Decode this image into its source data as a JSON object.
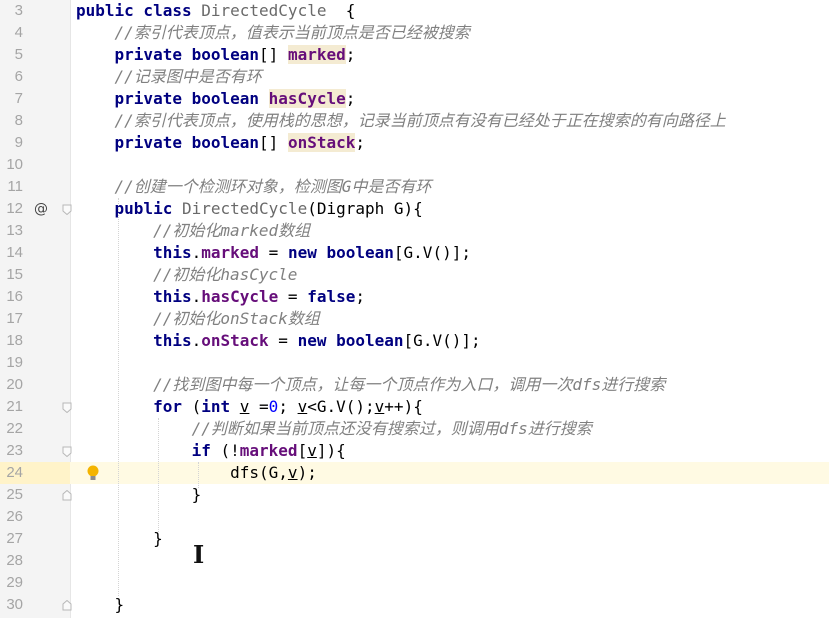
{
  "editor": {
    "lines": [
      {
        "n": "3",
        "tokens": [
          [
            "kw",
            "public class "
          ],
          [
            "cls",
            "DirectedCycle"
          ],
          [
            "",
            "  {"
          ]
        ]
      },
      {
        "n": "4",
        "tokens": [
          [
            "",
            "    "
          ],
          [
            "cm",
            "//索引代表顶点，值表示当前顶点是否已经被搜索"
          ]
        ]
      },
      {
        "n": "5",
        "tokens": [
          [
            "",
            "    "
          ],
          [
            "kw",
            "private boolean"
          ],
          [
            "",
            "[] "
          ],
          [
            "field hl",
            "marked"
          ],
          [
            "",
            ";"
          ]
        ]
      },
      {
        "n": "6",
        "tokens": [
          [
            "",
            "    "
          ],
          [
            "cm",
            "//记录图中是否有环"
          ]
        ]
      },
      {
        "n": "7",
        "tokens": [
          [
            "",
            "    "
          ],
          [
            "kw",
            "private boolean "
          ],
          [
            "field hl",
            "hasCycle"
          ],
          [
            "",
            ";"
          ]
        ]
      },
      {
        "n": "8",
        "tokens": [
          [
            "",
            "    "
          ],
          [
            "cm",
            "//索引代表顶点，使用栈的思想，记录当前顶点有没有已经处于正在搜索的有向路径上"
          ]
        ]
      },
      {
        "n": "9",
        "tokens": [
          [
            "",
            "    "
          ],
          [
            "kw",
            "private boolean"
          ],
          [
            "",
            "[] "
          ],
          [
            "field hl",
            "onStack"
          ],
          [
            "",
            ";"
          ]
        ]
      },
      {
        "n": "10",
        "tokens": []
      },
      {
        "n": "11",
        "tokens": [
          [
            "",
            "    "
          ],
          [
            "cm",
            "//创建一个检测环对象，检测图G中是否有环"
          ]
        ]
      },
      {
        "n": "12",
        "marker": "@",
        "tokens": [
          [
            "",
            "    "
          ],
          [
            "kw",
            "public "
          ],
          [
            "cls",
            "DirectedCycle"
          ],
          [
            "",
            "(Digraph G){"
          ]
        ]
      },
      {
        "n": "13",
        "tokens": [
          [
            "",
            "        "
          ],
          [
            "cm",
            "//初始化marked数组"
          ]
        ]
      },
      {
        "n": "14",
        "tokens": [
          [
            "",
            "        "
          ],
          [
            "kw",
            "this"
          ],
          [
            "",
            "."
          ],
          [
            "field",
            "marked"
          ],
          [
            "",
            " = "
          ],
          [
            "kw",
            "new boolean"
          ],
          [
            "",
            "[G.V()];"
          ]
        ]
      },
      {
        "n": "15",
        "tokens": [
          [
            "",
            "        "
          ],
          [
            "cm",
            "//初始化hasCycle"
          ]
        ]
      },
      {
        "n": "16",
        "tokens": [
          [
            "",
            "        "
          ],
          [
            "kw",
            "this"
          ],
          [
            "",
            "."
          ],
          [
            "field",
            "hasCycle"
          ],
          [
            "",
            " = "
          ],
          [
            "kw",
            "false"
          ],
          [
            "",
            ";"
          ]
        ]
      },
      {
        "n": "17",
        "tokens": [
          [
            "",
            "        "
          ],
          [
            "cm",
            "//初始化onStack数组"
          ]
        ]
      },
      {
        "n": "18",
        "tokens": [
          [
            "",
            "        "
          ],
          [
            "kw",
            "this"
          ],
          [
            "",
            "."
          ],
          [
            "field",
            "onStack"
          ],
          [
            "",
            " = "
          ],
          [
            "kw",
            "new boolean"
          ],
          [
            "",
            "[G.V()];"
          ]
        ]
      },
      {
        "n": "19",
        "tokens": []
      },
      {
        "n": "20",
        "tokens": [
          [
            "",
            "        "
          ],
          [
            "cm",
            "//找到图中每一个顶点，让每一个顶点作为入口，调用一次dfs进行搜索"
          ]
        ]
      },
      {
        "n": "21",
        "tokens": [
          [
            "",
            "        "
          ],
          [
            "kw",
            "for "
          ],
          [
            "",
            "("
          ],
          [
            "kw",
            "int "
          ],
          [
            "var",
            "v"
          ],
          [
            "",
            " ="
          ],
          [
            "num",
            "0"
          ],
          [
            "",
            "; "
          ],
          [
            "var",
            "v"
          ],
          [
            "",
            "<G.V();"
          ],
          [
            "var",
            "v"
          ],
          [
            "",
            "++){"
          ]
        ]
      },
      {
        "n": "22",
        "tokens": [
          [
            "",
            "            "
          ],
          [
            "cm",
            "//判断如果当前顶点还没有搜索过，则调用dfs进行搜索"
          ]
        ]
      },
      {
        "n": "23",
        "tokens": [
          [
            "",
            "            "
          ],
          [
            "kw",
            "if "
          ],
          [
            "",
            "(!"
          ],
          [
            "field",
            "marked"
          ],
          [
            "",
            "["
          ],
          [
            "var",
            "v"
          ],
          [
            "",
            "]){"
          ]
        ]
      },
      {
        "n": "24",
        "current": true,
        "bulb": true,
        "tokens": [
          [
            "",
            "                dfs(G,"
          ],
          [
            "var",
            "v"
          ],
          [
            "",
            ");"
          ]
        ]
      },
      {
        "n": "25",
        "tokens": [
          [
            "",
            "            }"
          ]
        ]
      },
      {
        "n": "26",
        "tokens": []
      },
      {
        "n": "27",
        "tokens": [
          [
            "",
            "        }"
          ]
        ]
      },
      {
        "n": "28",
        "tokens": []
      },
      {
        "n": "29",
        "tokens": []
      },
      {
        "n": "30",
        "tokens": [
          [
            "",
            "    }"
          ]
        ]
      }
    ]
  }
}
